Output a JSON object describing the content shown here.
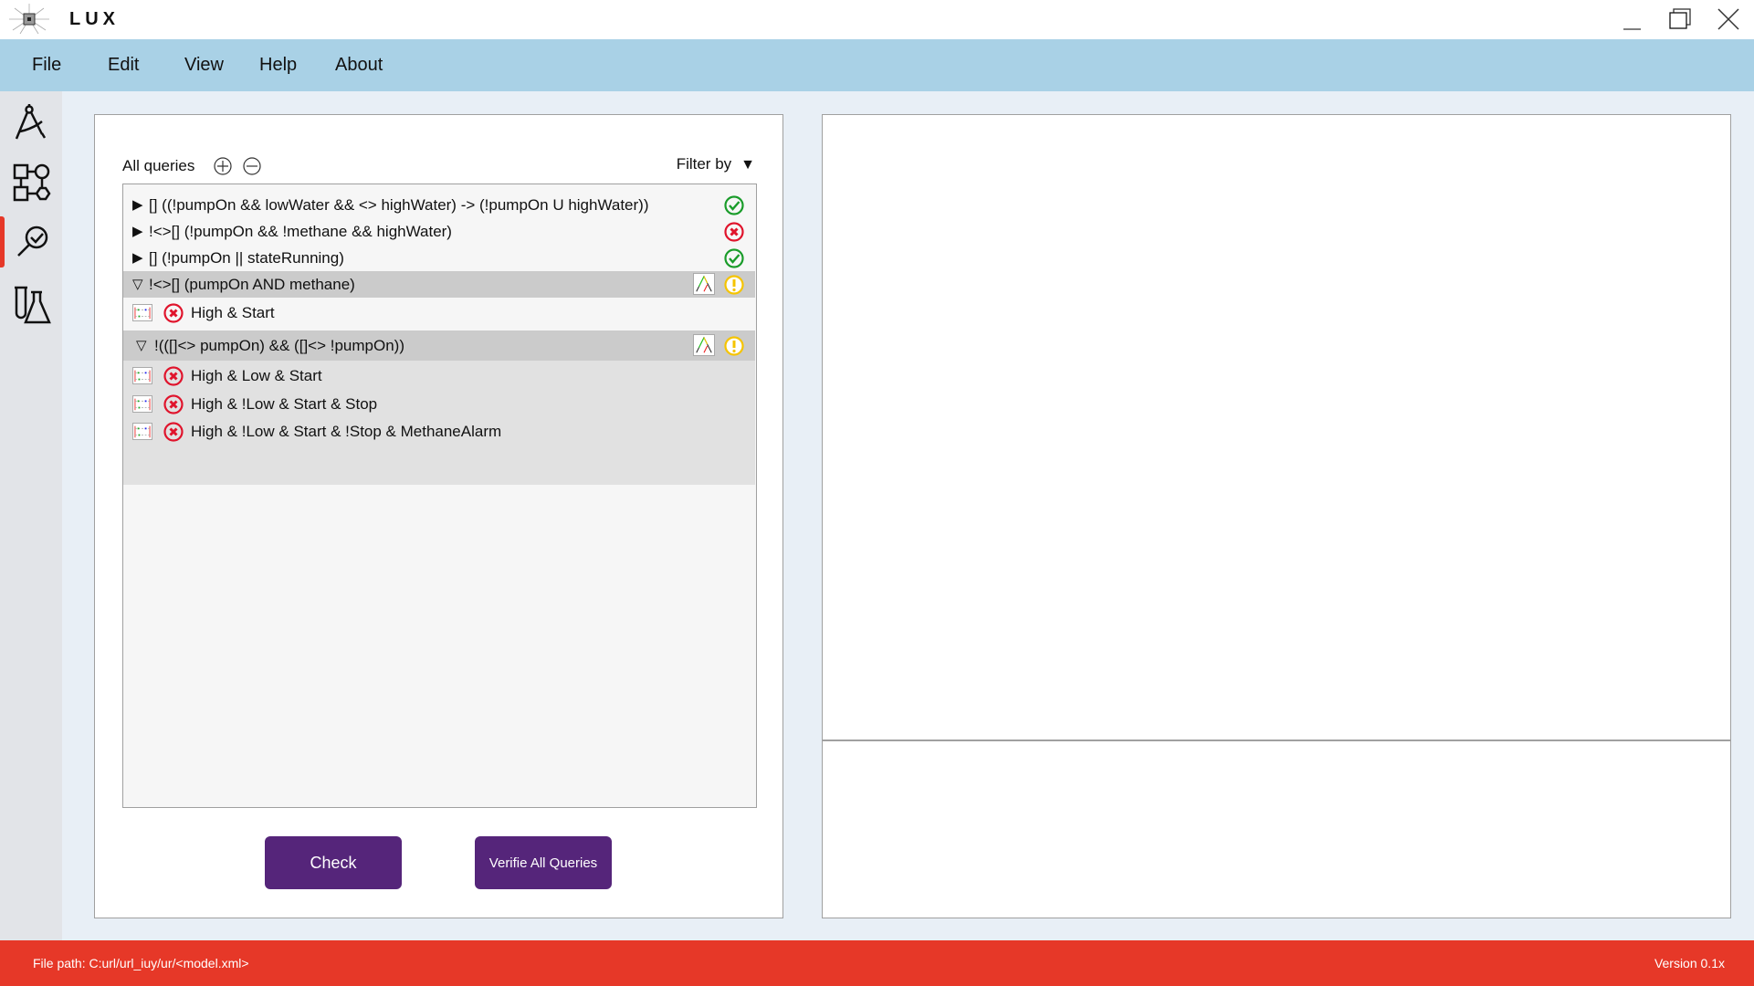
{
  "app": {
    "title": "LUX"
  },
  "menu": [
    "File",
    "Edit",
    "View",
    "Help",
    "About"
  ],
  "sidebar": {
    "items": [
      "editor",
      "model",
      "verification",
      "testing"
    ],
    "active": "verification"
  },
  "queries_panel": {
    "title": "All queries",
    "filter_label": "Filter by",
    "queries": [
      {
        "text": "[] ((!pumpOn && lowWater && <> highWater) -> (!pumpOn U highWater))",
        "status": "satisfied",
        "expanded": false
      },
      {
        "text": "!<>[] (!pumpOn && !methane && highWater)",
        "status": "failed",
        "expanded": false
      },
      {
        "text": "[] (!pumpOn || stateRunning)",
        "status": "satisfied",
        "expanded": false
      },
      {
        "text": "!<>[] (pumpOn AND methane)",
        "status": "warning",
        "expanded": true,
        "children": [
          "High & Start"
        ]
      },
      {
        "text": "!(([]<> pumpOn) && ([]<> !pumpOn))",
        "status": "warning",
        "expanded": true,
        "children": [
          "High & Low & Start",
          "High & !Low & Start & Stop",
          "High & !Low & Start & !Stop & MethaneAlarm"
        ]
      }
    ],
    "buttons": {
      "check": "Check",
      "verify_all": "Verifie All Queries"
    }
  },
  "status": {
    "file_path": "File path: C:url/url_iuy/ur/<model.xml>",
    "version": "Version 0.1x"
  },
  "colors": {
    "menubar": "#a9d1e6",
    "accent": "#55257a",
    "status": "#e63828",
    "ok": "#1a9c2a",
    "fail": "#e0142c",
    "warn": "#f5c400"
  }
}
